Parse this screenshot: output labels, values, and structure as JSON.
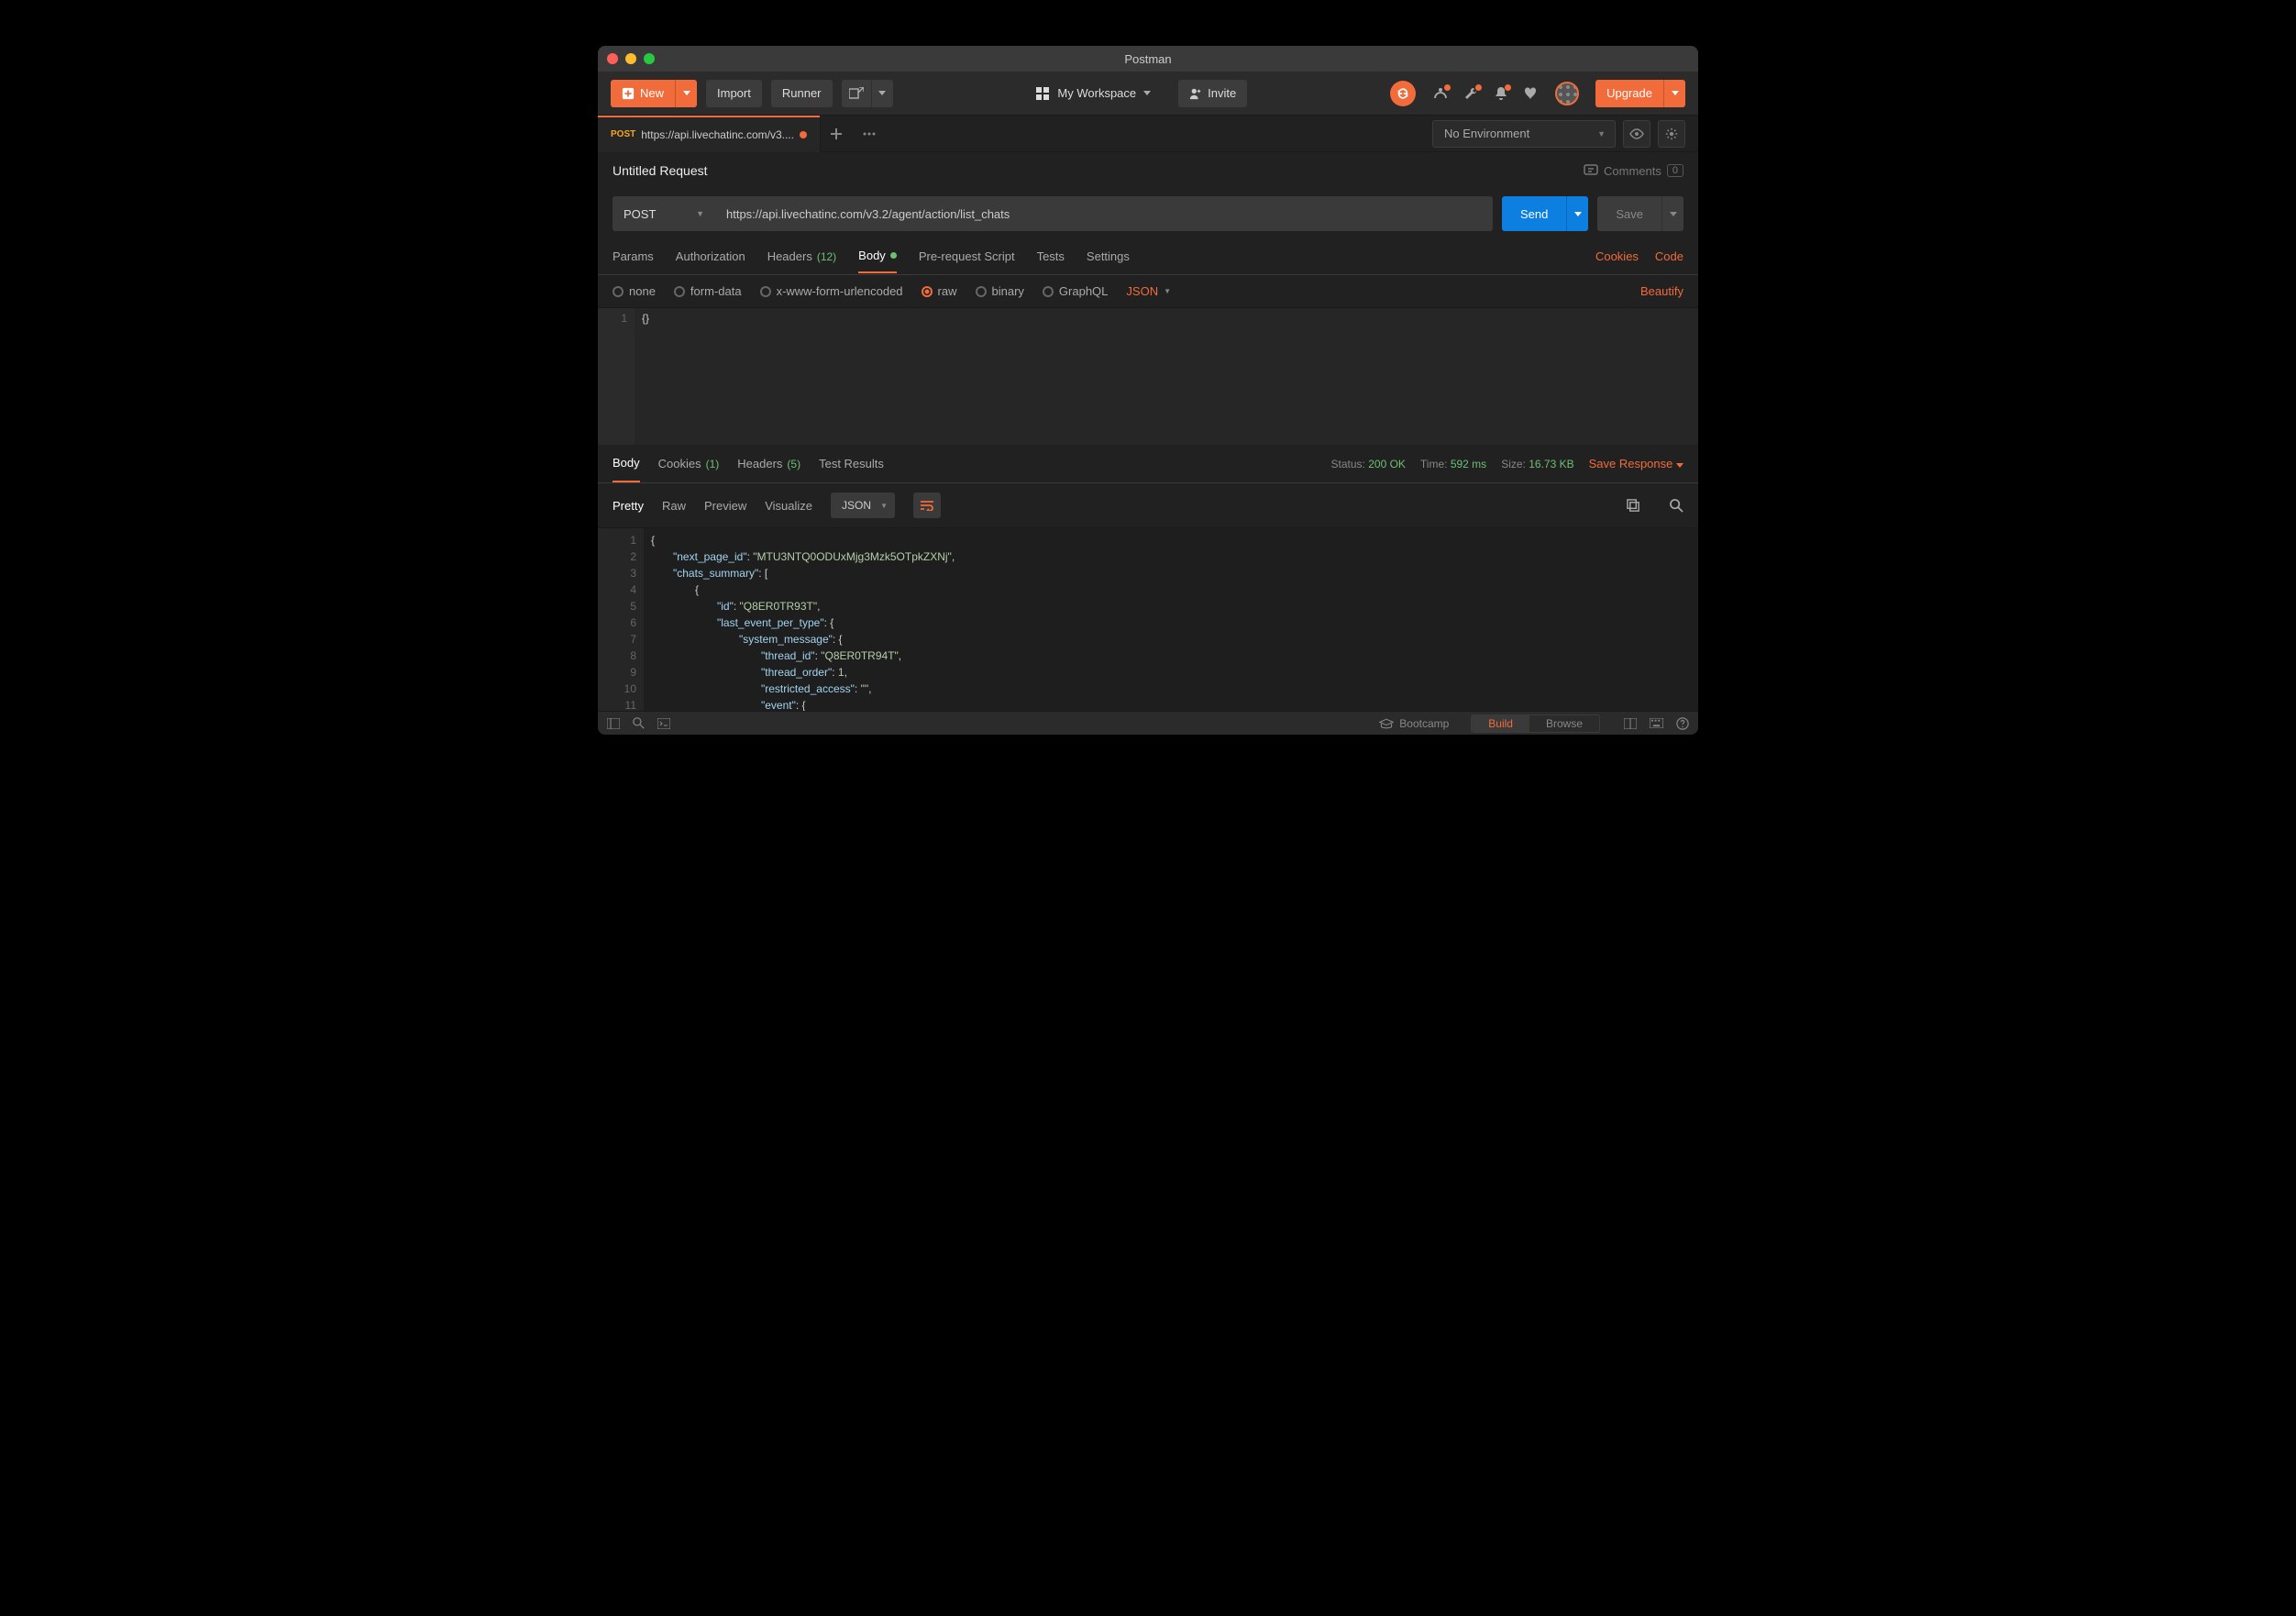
{
  "titlebar": {
    "app_name": "Postman"
  },
  "toolbar": {
    "new_label": "New",
    "import_label": "Import",
    "runner_label": "Runner",
    "workspace_label": "My Workspace",
    "invite_label": "Invite",
    "upgrade_label": "Upgrade"
  },
  "tabs": {
    "method": "POST",
    "url_short": "https://api.livechatinc.com/v3....",
    "env_label": "No Environment"
  },
  "request": {
    "name": "Untitled Request",
    "comments_label": "Comments",
    "comments_count": "0",
    "method": "POST",
    "url": "https://api.livechatinc.com/v3.2/agent/action/list_chats",
    "send_label": "Send",
    "save_label": "Save"
  },
  "req_tabs": {
    "params": "Params",
    "authorization": "Authorization",
    "headers": "Headers",
    "headers_count": "(12)",
    "body": "Body",
    "prereq": "Pre-request Script",
    "tests": "Tests",
    "settings": "Settings",
    "cookies": "Cookies",
    "code": "Code"
  },
  "body_opts": {
    "none": "none",
    "formdata": "form-data",
    "xwww": "x-www-form-urlencoded",
    "raw": "raw",
    "binary": "binary",
    "graphql": "GraphQL",
    "content_type": "JSON",
    "beautify": "Beautify"
  },
  "body_editor": {
    "line1": "1",
    "content": "{}"
  },
  "resp_tabs": {
    "body": "Body",
    "cookies": "Cookies",
    "cookies_count": "(1)",
    "headers": "Headers",
    "headers_count": "(5)",
    "test_results": "Test Results"
  },
  "resp_meta": {
    "status_label": "Status:",
    "status_value": "200 OK",
    "time_label": "Time:",
    "time_value": "592 ms",
    "size_label": "Size:",
    "size_value": "16.73 KB",
    "save_response": "Save Response"
  },
  "resp_sub": {
    "pretty": "Pretty",
    "raw": "Raw",
    "preview": "Preview",
    "visualize": "Visualize",
    "format": "JSON"
  },
  "response_lines": [
    {
      "n": "1",
      "indent": 0,
      "html": "{"
    },
    {
      "n": "2",
      "indent": 1,
      "html": "<span class='tok-key'>\"next_page_id\"</span>: <span class='tok-str'>\"MTU3NTQ0ODUxMjg3Mzk5OTpkZXNj\"</span>,"
    },
    {
      "n": "3",
      "indent": 1,
      "html": "<span class='tok-key'>\"chats_summary\"</span>: ["
    },
    {
      "n": "4",
      "indent": 2,
      "html": "{"
    },
    {
      "n": "5",
      "indent": 3,
      "html": "<span class='tok-key'>\"id\"</span>: <span class='tok-str'>\"Q8ER0TR93T\"</span>,"
    },
    {
      "n": "6",
      "indent": 3,
      "html": "<span class='tok-key'>\"last_event_per_type\"</span>: {"
    },
    {
      "n": "7",
      "indent": 4,
      "html": "<span class='tok-key'>\"system_message\"</span>: {"
    },
    {
      "n": "8",
      "indent": 5,
      "html": "<span class='tok-key'>\"thread_id\"</span>: <span class='tok-str'>\"Q8ER0TR94T\"</span>,"
    },
    {
      "n": "9",
      "indent": 5,
      "html": "<span class='tok-key'>\"thread_order\"</span>: <span class='tok-num'>1</span>,"
    },
    {
      "n": "10",
      "indent": 5,
      "html": "<span class='tok-key'>\"restricted_access\"</span>: <span class='tok-str'>\"\"</span>,"
    },
    {
      "n": "11",
      "indent": 5,
      "html": "<span class='tok-key'>\"event\"</span>: {"
    }
  ],
  "status": {
    "bootcamp": "Bootcamp",
    "build": "Build",
    "browse": "Browse"
  }
}
